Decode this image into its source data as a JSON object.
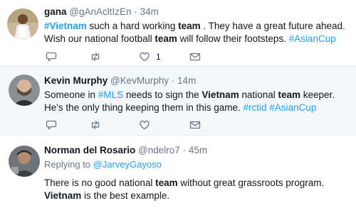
{
  "tweets": [
    {
      "name": "gana",
      "handle": "@gAnAcltIzEn",
      "time": "34m",
      "body_parts": [
        "#Vietnam",
        " such a hard working ",
        "team",
        " . They have a great future ahead. Wish our national football ",
        "team",
        " will follow their footsteps. ",
        "#AsianCup"
      ],
      "actions": {
        "reply_icon": "reply-icon",
        "retweet_icon": "retweet-icon",
        "like_icon": "heart-icon",
        "like_count": "1",
        "dm_icon": "envelope-icon"
      }
    },
    {
      "name": "Kevin Murphy",
      "handle": "@KevMurphy",
      "time": "14m",
      "body_parts": [
        "Someone in ",
        "#MLS",
        " needs to sign the ",
        "Vietnam",
        " national ",
        "team",
        " keeper. He's the only thing keeping them in this game. ",
        "#rctid",
        " ",
        "#AsianCup"
      ],
      "actions": {
        "reply_icon": "reply-icon",
        "retweet_icon": "retweet-icon",
        "like_icon": "heart-icon",
        "dm_icon": "envelope-icon"
      }
    },
    {
      "name": "Norman del Rosario",
      "handle": "@ndelro7",
      "time": "45m",
      "replying_prefix": "Replying to ",
      "replying_handle": "@JarveyGayoso",
      "body_parts": [
        "There is no good national ",
        "team",
        " without great grassroots program. ",
        "Vietnam",
        " is the best example."
      ]
    }
  ],
  "dot": "·",
  "colors": {
    "link": "#1da1f2",
    "muted": "#657786",
    "divider": "#e6ecf0",
    "highlight_bg": "#f5f8fa"
  }
}
